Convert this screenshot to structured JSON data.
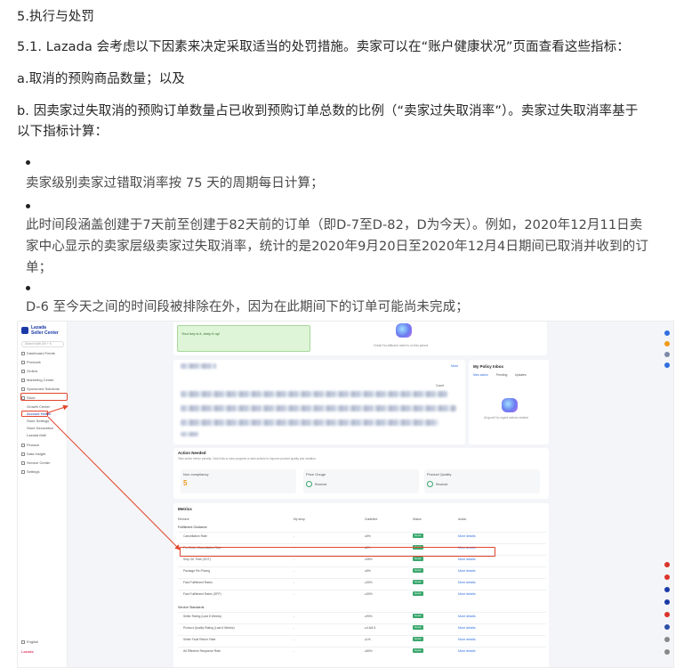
{
  "doc": {
    "heading": "5.执行与处罚",
    "p1": "5.1. Lazada 会考虑以下因素来决定采取适当的处罚措施。卖家可以在“账户健康状况”页面查看这些指标：",
    "pa": "a.取消的预购商品数量；以及",
    "pb_line1": "b. 因卖家过失取消的预购订单数量占已收到预购订单总数的比例（“卖家过失取消率”）。卖家过失取消率基于",
    "pb_line2": "以下指标计算：",
    "bullets": [
      {
        "lines": [
          "卖家级别卖家过错取消率按 75 天的周期每日计算；"
        ]
      },
      {
        "lines": [
          "此时间段涵盖创建于7天前至创建于82天前的订单（即D-7至D-82，D为今天）。例如，2020年12月11日卖",
          "家中心显示的卖家层级卖家过失取消率，统计的是2020年9月20日至2020年12月4日期间已取消并收到的订",
          "单；"
        ]
      },
      {
        "lines": [
          "D-6 至今天之间的时间段被排除在外，因为在此期间下的订单可能尚未完成；"
        ]
      }
    ]
  },
  "screenshot": {
    "brand_line1": "Lazada",
    "brand_line2": "Seller Center",
    "search_placeholder": "Search with Ctrl + K",
    "sidebar": [
      "Dashboard Feeds",
      "Products",
      "Orders",
      "Marketing Center",
      "Sponsored Solutions",
      "Store",
      "Growth Center",
      "Account Health",
      "Store Settings",
      "Store Decoration",
      "Lazada Mall",
      "Finance",
      "Data Insight",
      "Service Center",
      "Settings"
    ],
    "footer_lang": "English",
    "footer_logo": "Lazada",
    "banner": "Your key is it, keep it up!",
    "banner_sub": "Great! No Affected rated is on this period.",
    "more": "More",
    "table_head": "Count",
    "policy_title": "My Policy Inbox",
    "policy_tabs": [
      "New action",
      "Pending",
      "Updates"
    ],
    "policy_empty": "All good! No urgent actions needed",
    "action_title": "Action Needed",
    "action_sub": "Take action before penalty. Click links to view progress or take actions to improve product quality and violation.",
    "action_cards": [
      {
        "label": "Non compliancy",
        "value": "5"
      },
      {
        "label": "Price Gouge",
        "value": "Resolved"
      },
      {
        "label": "Product Quality",
        "value": "Resolved"
      }
    ],
    "metrics_title": "Metrics",
    "metrics_cols": [
      "Element",
      "My shop",
      "Guideline",
      "Status",
      "Action"
    ],
    "groups": [
      {
        "name": "Fulfillment Guidance",
        "rows": [
          {
            "name": "Cancellation Rate",
            "mine": "-",
            "guide": "≤5%",
            "status": "Good",
            "action": "More details"
          },
          {
            "name": "Pre-Order Cancellation Rate",
            "mine": "-",
            "guide": "≤2%",
            "status": "Good",
            "action": "More details"
          },
          {
            "name": "Ship On Time (SOT)",
            "mine": "-",
            "guide": "≥95%",
            "status": "Good",
            "action": "More details"
          },
          {
            "name": "Package Re-Pricing",
            "mine": "-",
            "guide": "≤5%",
            "status": "Good",
            "action": "More details"
          },
          {
            "name": "Fast Fulfillment Rates",
            "mine": "-",
            "guide": "≥30%",
            "status": "Good",
            "action": "More details"
          },
          {
            "name": "Fast Fulfillment Rates (SFP)",
            "mine": "-",
            "guide": "≥30%",
            "status": "Good",
            "action": "More details"
          }
        ]
      },
      {
        "name": "Service Standards",
        "rows": [
          {
            "name": "Seller Rating (Last 6 Weeks)",
            "mine": "-",
            "guide": "≥90%",
            "status": "Good",
            "action": "More details"
          },
          {
            "name": "Product Quality Rating (Last 6 Weeks)",
            "mine": "-",
            "guide": "≥4.6/4.5",
            "status": "Good",
            "action": "More details"
          },
          {
            "name": "Seller Fault Return Rate",
            "mine": "-",
            "guide": "≤1%",
            "status": "Good",
            "action": "More details"
          },
          {
            "name": "IM Effective Response Rate",
            "mine": "-",
            "guide": "≥60%",
            "status": "Good",
            "action": "More details"
          }
        ]
      }
    ]
  }
}
